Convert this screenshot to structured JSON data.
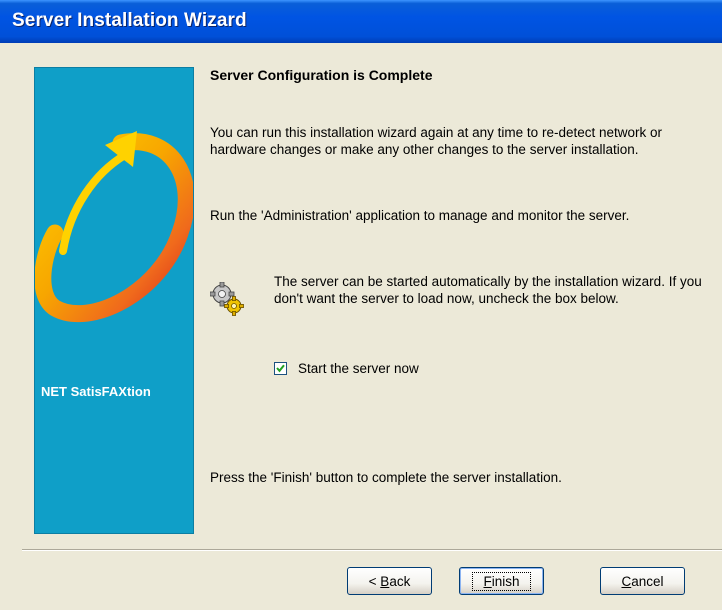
{
  "window": {
    "title": "Server Installation Wizard"
  },
  "side_panel": {
    "label": "NET SatisFAXtion",
    "logo_icon": "circular-arrow-logo-icon",
    "background": "#0f9fc8"
  },
  "content": {
    "heading": "Server Configuration is Complete",
    "paragraph1": "You can run this installation wizard again at any time to re-detect network or hardware changes or make any other changes to the server installation.",
    "paragraph2": "Run the 'Administration' application to manage and monitor the server.",
    "gear_icon": "gears-icon",
    "paragraph3": "The server can be started automatically by the installation wizard. If you don't want the server to load now, uncheck the box below.",
    "checkbox": {
      "label": "Start the server now",
      "checked": true
    },
    "paragraph4": "Press the 'Finish' button to complete the server installation."
  },
  "buttons": {
    "back": {
      "prefix": "< ",
      "mnemonic": "B",
      "rest": "ack"
    },
    "finish": {
      "mnemonic": "F",
      "rest": "inish"
    },
    "cancel": {
      "mnemonic": "C",
      "rest": "ancel"
    }
  },
  "colors": {
    "titlebar": "#0054e3",
    "dialog_bg": "#ece9d8",
    "button_border": "#003c74"
  }
}
